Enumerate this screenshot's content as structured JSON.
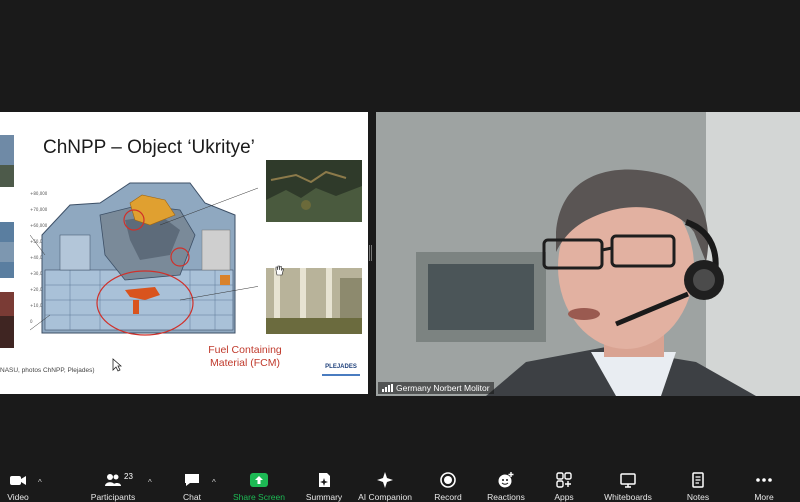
{
  "slide": {
    "title": "ChNPP – Object ‘Ukritye’",
    "fcm_label_line1": "Fuel Containing",
    "fcm_label_line2": "Material (FCM)",
    "credit": "NASU, photos ChNPP, Plejades)",
    "logo": "PLEJADES",
    "elevation_labels": [
      "+80,000",
      "+70,000",
      "+60,000",
      "+50,000",
      "+40,000",
      "+30,000",
      "+20,000",
      "+10,000",
      "0"
    ]
  },
  "video": {
    "participant_name": "Germany Norbert Molitor"
  },
  "toolbar": {
    "items": [
      {
        "label": "Video",
        "icon": "video-camera-icon"
      },
      {
        "label": "Participants",
        "icon": "participants-icon",
        "count": "23"
      },
      {
        "label": "Chat",
        "icon": "chat-bubble-icon"
      },
      {
        "label": "Share Screen",
        "icon": "share-screen-icon"
      },
      {
        "label": "Summary",
        "icon": "summary-icon"
      },
      {
        "label": "AI Companion",
        "icon": "sparkle-icon"
      },
      {
        "label": "Record",
        "icon": "record-icon"
      },
      {
        "label": "Reactions",
        "icon": "reactions-icon"
      },
      {
        "label": "Apps",
        "icon": "apps-icon"
      },
      {
        "label": "Whiteboards",
        "icon": "whiteboard-icon"
      },
      {
        "label": "Notes",
        "icon": "notes-icon"
      },
      {
        "label": "More",
        "icon": "more-dots-icon"
      }
    ]
  },
  "colors": {
    "background": "#1a1a1a",
    "share_green": "#1db954",
    "fcm_red": "#c0392b"
  }
}
